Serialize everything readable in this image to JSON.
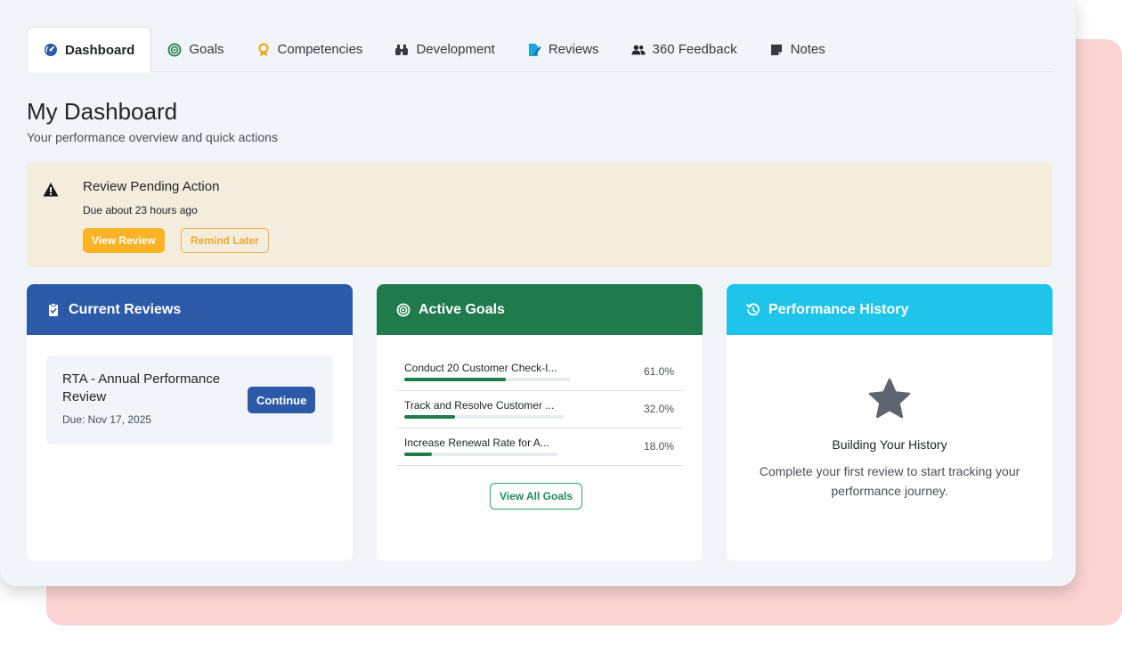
{
  "tabs": [
    {
      "label": "Dashboard",
      "icon": "dashboard-gauge-icon",
      "active": true
    },
    {
      "label": "Goals",
      "icon": "target-icon",
      "active": false
    },
    {
      "label": "Competencies",
      "icon": "award-icon",
      "active": false
    },
    {
      "label": "Development",
      "icon": "binoculars-icon",
      "active": false
    },
    {
      "label": "Reviews",
      "icon": "edit-document-icon",
      "active": false
    },
    {
      "label": "360 Feedback",
      "icon": "users-icon",
      "active": false
    },
    {
      "label": "Notes",
      "icon": "sticky-note-icon",
      "active": false
    }
  ],
  "page": {
    "title": "My Dashboard",
    "subtitle": "Your performance overview and quick actions"
  },
  "alert": {
    "icon": "warning-triangle-icon",
    "title": "Review Pending Action",
    "due": "Due about 23 hours ago",
    "view_label": "View Review",
    "remind_label": "Remind Later"
  },
  "current_reviews": {
    "title": "Current Reviews",
    "icon": "clipboard-check-icon",
    "color": "#2c5aa8",
    "review": {
      "name": "RTA - Annual Performance Review",
      "due": "Due: Nov 17, 2025",
      "continue_label": "Continue"
    }
  },
  "active_goals": {
    "title": "Active Goals",
    "icon": "target-icon",
    "color": "#1f7a4c",
    "goals": [
      {
        "name": "Conduct 20 Customer Check-I...",
        "percent_label": "61.0%",
        "progress": 0.61
      },
      {
        "name": "Track and Resolve Customer ...",
        "percent_label": "32.0%",
        "progress": 0.32
      },
      {
        "name": "Increase Renewal Rate for A...",
        "percent_label": "18.0%",
        "progress": 0.18
      }
    ],
    "view_all_label": "View All Goals"
  },
  "performance_history": {
    "title": "Performance History",
    "icon": "history-icon",
    "color": "#1ec4e9",
    "empty_icon": "star-icon",
    "empty_title": "Building Your History",
    "empty_text": "Complete your first review to start tracking your performance journey."
  }
}
